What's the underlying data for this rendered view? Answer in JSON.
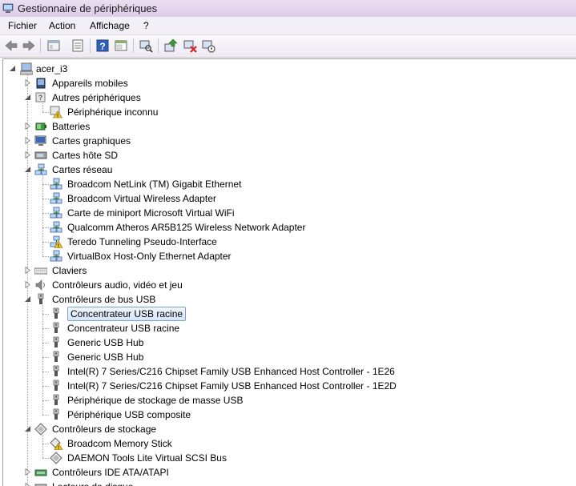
{
  "window": {
    "title": "Gestionnaire de périphériques"
  },
  "menu": [
    "Fichier",
    "Action",
    "Affichage",
    "?"
  ],
  "toolbar": [
    "back-icon",
    "forward-icon",
    "computer-view-icon",
    "properties-icon",
    "help-icon",
    "view-icon",
    "scan-hardware-icon",
    "update-driver-icon",
    "uninstall-icon",
    "disable-icon"
  ],
  "tree": {
    "root": "acer_i3",
    "nodes": [
      {
        "label": "Appareils mobiles",
        "level": 1,
        "icon": "mobile-icon",
        "expander": "collapsed"
      },
      {
        "label": "Autres périphériques",
        "level": 1,
        "icon": "unknown-icon",
        "expander": "expanded"
      },
      {
        "label": "Périphérique inconnu",
        "level": 2,
        "icon": "warning-device-icon",
        "expander": "none"
      },
      {
        "label": "Batteries",
        "level": 1,
        "icon": "battery-icon",
        "expander": "collapsed"
      },
      {
        "label": "Cartes graphiques",
        "level": 1,
        "icon": "display-icon",
        "expander": "collapsed"
      },
      {
        "label": "Cartes hôte SD",
        "level": 1,
        "icon": "sd-host-icon",
        "expander": "collapsed"
      },
      {
        "label": "Cartes réseau",
        "level": 1,
        "icon": "network-icon",
        "expander": "expanded"
      },
      {
        "label": "Broadcom NetLink (TM) Gigabit Ethernet",
        "level": 2,
        "icon": "network-icon",
        "expander": "none"
      },
      {
        "label": "Broadcom Virtual Wireless Adapter",
        "level": 2,
        "icon": "network-icon",
        "expander": "none"
      },
      {
        "label": "Carte de miniport Microsoft Virtual WiFi",
        "level": 2,
        "icon": "network-icon",
        "expander": "none"
      },
      {
        "label": "Qualcomm Atheros AR5B125 Wireless Network Adapter",
        "level": 2,
        "icon": "network-icon",
        "expander": "none"
      },
      {
        "label": "Teredo Tunneling Pseudo-Interface",
        "level": 2,
        "icon": "network-warning-icon",
        "expander": "none"
      },
      {
        "label": "VirtualBox Host-Only Ethernet Adapter",
        "level": 2,
        "icon": "network-icon",
        "expander": "none"
      },
      {
        "label": "Claviers",
        "level": 1,
        "icon": "keyboard-icon",
        "expander": "collapsed"
      },
      {
        "label": "Contrôleurs audio, vidéo et jeu",
        "level": 1,
        "icon": "audio-icon",
        "expander": "collapsed"
      },
      {
        "label": "Contrôleurs de bus USB",
        "level": 1,
        "icon": "usb-icon",
        "expander": "expanded"
      },
      {
        "label": "Concentrateur USB racine",
        "level": 2,
        "icon": "usb-icon",
        "expander": "none",
        "selected": true
      },
      {
        "label": "Concentrateur USB racine",
        "level": 2,
        "icon": "usb-icon",
        "expander": "none"
      },
      {
        "label": "Generic USB Hub",
        "level": 2,
        "icon": "usb-icon",
        "expander": "none"
      },
      {
        "label": "Generic USB Hub",
        "level": 2,
        "icon": "usb-icon",
        "expander": "none"
      },
      {
        "label": "Intel(R) 7 Series/C216 Chipset Family USB Enhanced Host Controller - 1E26",
        "level": 2,
        "icon": "usb-icon",
        "expander": "none"
      },
      {
        "label": "Intel(R) 7 Series/C216 Chipset Family USB Enhanced Host Controller - 1E2D",
        "level": 2,
        "icon": "usb-icon",
        "expander": "none"
      },
      {
        "label": "Périphérique de stockage de masse USB",
        "level": 2,
        "icon": "usb-icon",
        "expander": "none"
      },
      {
        "label": "Périphérique USB composite",
        "level": 2,
        "icon": "usb-icon",
        "expander": "none"
      },
      {
        "label": "Contrôleurs de stockage",
        "level": 1,
        "icon": "storage-icon",
        "expander": "expanded"
      },
      {
        "label": "Broadcom Memory Stick",
        "level": 2,
        "icon": "storage-warning-icon",
        "expander": "none"
      },
      {
        "label": "DAEMON Tools Lite Virtual SCSI Bus",
        "level": 2,
        "icon": "storage-icon",
        "expander": "none"
      },
      {
        "label": "Contrôleurs IDE ATA/ATAPI",
        "level": 1,
        "icon": "ide-icon",
        "expander": "collapsed"
      },
      {
        "label": "Lecteurs de disque",
        "level": 1,
        "icon": "disk-icon",
        "expander": "collapsed"
      }
    ]
  },
  "colors": {
    "titlebar": "#dccde8",
    "selection_border": "#7da2ce",
    "selection_fill": "#d5e5f9"
  }
}
